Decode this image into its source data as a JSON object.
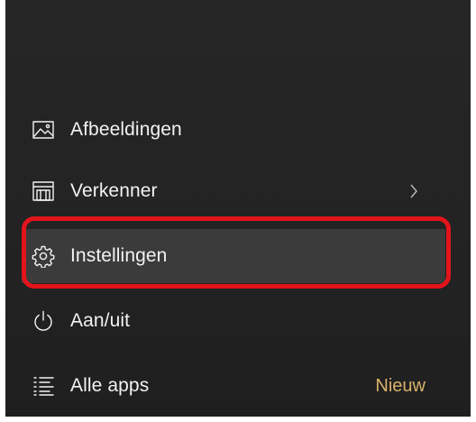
{
  "menu": {
    "items": [
      {
        "label": "Afbeeldingen",
        "icon": "pictures-icon"
      },
      {
        "label": "Verkenner",
        "icon": "file-explorer-icon",
        "has_submenu": true
      },
      {
        "label": "Instellingen",
        "icon": "gear-icon",
        "highlighted": true
      },
      {
        "label": "Aan/uit",
        "icon": "power-icon"
      },
      {
        "label": "Alle apps",
        "icon": "all-apps-list-icon",
        "badge": "Nieuw"
      }
    ]
  },
  "colors": {
    "panel_background": "#232323",
    "text": "#f2f2f2",
    "highlight_ring": "#e3141b",
    "badge": "#d9b36a",
    "hover_background": "#3b3b3b"
  }
}
